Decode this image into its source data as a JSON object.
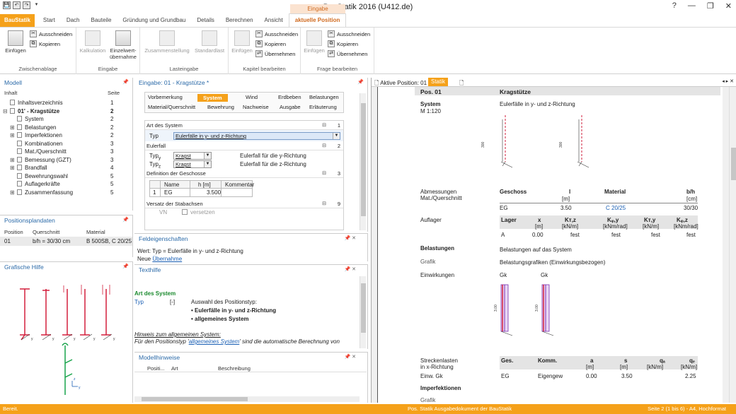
{
  "app": {
    "title": "BauStatik 2016 (U412.de)",
    "qat": [
      "💾",
      "↶",
      "↷",
      "▾"
    ],
    "win": [
      "?",
      "—",
      "❐",
      "✕"
    ]
  },
  "ribbon": {
    "context_label": "Eingabe",
    "tabs": [
      "BauStatik",
      "Start",
      "Dach",
      "Bauteile",
      "Gründung und Grundbau",
      "Details",
      "Berechnen",
      "Ansicht",
      "aktuelle Position"
    ],
    "groups": {
      "zwischenablage": {
        "label": "Zwischenablage",
        "paste": "Einfügen",
        "cut": "Ausschneiden",
        "copy": "Kopieren"
      },
      "eingabe": {
        "label": "Eingabe",
        "kalk": "Kalkulation",
        "einzelwert": "Einzelwert-\nübernahme"
      },
      "lasteingabe": {
        "label": "Lasteingabe",
        "zusammen": "Zusammenstellung",
        "standard": "Standardlast"
      },
      "kapitel": {
        "label": "Kapitel bearbeiten",
        "paste": "Einfügen",
        "cut": "Ausschneiden",
        "copy": "Kopieren",
        "take": "Übernehmen"
      },
      "frage": {
        "label": "Frage bearbeiten",
        "paste": "Einfügen",
        "cut": "Ausschneiden",
        "copy": "Kopieren",
        "take": "Übernehmen"
      }
    }
  },
  "modell": {
    "title": "Modell",
    "col_inhalt": "Inhalt",
    "col_seite": "Seite",
    "items": [
      {
        "label": "Inhaltsverzeichnis",
        "page": "1",
        "indent": 0,
        "bold": false,
        "exp": ""
      },
      {
        "label": "01' - Kragstütze",
        "page": "2",
        "indent": 0,
        "bold": true,
        "exp": "⊟"
      },
      {
        "label": "System",
        "page": "2",
        "indent": 1,
        "bold": false,
        "exp": ""
      },
      {
        "label": "Belastungen",
        "page": "2",
        "indent": 1,
        "bold": false,
        "exp": "⊞"
      },
      {
        "label": "Imperfektionen",
        "page": "2",
        "indent": 1,
        "bold": false,
        "exp": "⊞"
      },
      {
        "label": "Kombinationen",
        "page": "3",
        "indent": 1,
        "bold": false,
        "exp": ""
      },
      {
        "label": "Mat./Querschnitt",
        "page": "3",
        "indent": 1,
        "bold": false,
        "exp": ""
      },
      {
        "label": "Bemessung (GZT)",
        "page": "3",
        "indent": 1,
        "bold": false,
        "exp": "⊞"
      },
      {
        "label": "Brandfall",
        "page": "4",
        "indent": 1,
        "bold": false,
        "exp": "⊞"
      },
      {
        "label": "Bewehrungswahl",
        "page": "5",
        "indent": 1,
        "bold": false,
        "exp": ""
      },
      {
        "label": "Auflagerkräfte",
        "page": "5",
        "indent": 1,
        "bold": false,
        "exp": ""
      },
      {
        "label": "Zusammenfassung",
        "page": "5",
        "indent": 1,
        "bold": false,
        "exp": "⊞"
      }
    ]
  },
  "positionsplan": {
    "title": "Positionsplandaten",
    "cols": [
      "Position",
      "Querschnitt",
      "Material"
    ],
    "row": [
      "01",
      "b/h = 30/30 cm",
      "B 500SB, C 20/25"
    ]
  },
  "grafische_hilfe": {
    "title": "Grafische Hilfe"
  },
  "eingabe": {
    "title": "Eingabe: 01 - Kragstütze *",
    "nav_row1": [
      "Vorbemerkung",
      "System",
      "Wind",
      "Erdbeben",
      "Belastungen"
    ],
    "nav_row2": [
      "Material/Querschnitt",
      "Bewehrung",
      "Nachweise",
      "Ausgabe",
      "Erläuterung"
    ],
    "sections": [
      {
        "label": "Art des System",
        "num": "1"
      },
      {
        "label": "Eulerfall",
        "num": "2"
      },
      {
        "label": "Definition der Geschosse",
        "num": "3"
      },
      {
        "label": "Versatz der Stabachsen",
        "num": "9"
      }
    ],
    "typ_label": "Typ",
    "typ_value": "Eulerfälle in y- und z-Richtung",
    "typy_label": "Typ",
    "typy_sub": "y",
    "typy_value": "Kragst",
    "typy_desc": "Eulerfall für die y-Richtung",
    "typz_label": "Typ",
    "typz_sub": "z",
    "typz_value": "Kragst",
    "typz_desc": "Eulerfall für die z-Richtung",
    "geschoss_cols": [
      "Name",
      "h [m]",
      "Kommentar"
    ],
    "geschoss_row": [
      "1",
      "EG",
      "3.500",
      ""
    ],
    "versatz_row": [
      "VN",
      "versetzen"
    ]
  },
  "feldeig": {
    "title": "Feldeigenschaften",
    "line1": "Wert: Typ = Eulerfälle in y- und z-Richtung",
    "line2a": "Neue ",
    "line2b": "Übernahme"
  },
  "texthilfe": {
    "title": "Texthilfe",
    "heading": "Art des System",
    "typ": "Typ",
    "unit": "[-]",
    "desc": "Auswahl des Positionstyp:",
    "b1": "• Eulerfälle in y- und z-Richtung",
    "b2": "• allgemeines System",
    "hint": "Hinweis zum allgemeinen System:",
    "hint2a": "Für den Positionstyp '",
    "hint2b": "allgemeines System",
    "hint2c": "' sind die automatische Berechnung von"
  },
  "modellhinweise": {
    "title": "Modellhinweise",
    "cols": [
      "Positi...",
      "Art",
      "Beschreibung"
    ]
  },
  "docview": {
    "tab_label": "Aktive Position: 01",
    "tab_static": "Statik",
    "pos": "Pos. 01",
    "pos_title": "Kragstütze",
    "system": "System",
    "scale": "M 1:120",
    "system_desc": "Eulerfälle in y- und z-Richtung",
    "dim": "300",
    "abm": "Abmessungen",
    "matq": "Mat./Querschnitt",
    "abm_cols": [
      "Geschoss",
      "l",
      "Material",
      "b/h"
    ],
    "abm_units": [
      "[m]",
      "[cm]"
    ],
    "abm_row": [
      "EG",
      "3.50",
      "C 20/25",
      "30/30"
    ],
    "auflager": "Auflager",
    "auf_cols": [
      "Lager",
      "x",
      "Kᴛ,z",
      "Kᵩ,y",
      "Kᴛ,y",
      "Kᵩ,z"
    ],
    "auf_units": [
      "[m]",
      "[kN/m]",
      "[kNm/rad]",
      "[kN/m]",
      "[kNm/rad]"
    ],
    "auf_row": [
      "A",
      "0.00",
      "fest",
      "fest",
      "fest",
      "fest"
    ],
    "belastungen": "Belastungen",
    "bel_desc": "Belastungen auf das System",
    "grafik": "Grafik",
    "grafik_desc": "Belastungsgrafiken (Einwirkungsbezogen)",
    "einwirkungen": "Einwirkungen",
    "gk": "Gk",
    "dim2": "3.00",
    "strecken": "Streckenlasten",
    "strecken2": "in x-Richtung",
    "str_cols": [
      "Ges.",
      "Komm.",
      "a",
      "s",
      "qₐ",
      "qₑ"
    ],
    "str_units": [
      "[m]",
      "[m]",
      "[kN/m]",
      "[kN/m]"
    ],
    "str_row_label": "Einw. Gk",
    "str_row": [
      "EG",
      "Eigengew",
      "0.00",
      "3.50",
      "",
      "2.25"
    ],
    "imperf": "Imperfektionen",
    "grafik2": "Grafik"
  },
  "status": {
    "left": "Bereit.",
    "center": "Pos. Statik  Ausgabedokument der BauStatik",
    "right": "Seite 2 (1 bis 6) - A4, Hochformat"
  },
  "colors": {
    "accent": "#f5a11a",
    "title_blue": "#2b6aa8",
    "load": "#7a2fb0",
    "support": "#d21f3c"
  }
}
